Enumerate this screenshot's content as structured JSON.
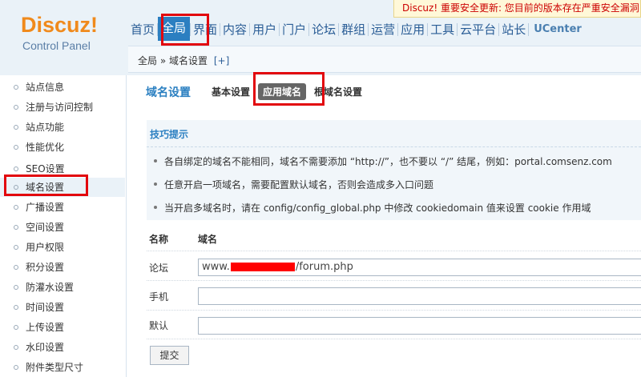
{
  "alert": {
    "text": "Discuz! 重要安全更新: 您目前的版本存在严重安全漏洞"
  },
  "logo": {
    "title": "Discuz!",
    "subtitle": "Control Panel"
  },
  "topnav": {
    "items": [
      "首页",
      "全局",
      "界面",
      "内容",
      "用户",
      "门户",
      "论坛",
      "群组",
      "运营",
      "应用",
      "工具",
      "云平台",
      "站长",
      "UCenter"
    ],
    "active_index": 1
  },
  "breadcrumb": {
    "section": "全局",
    "separator": "»",
    "page": "域名设置",
    "add": "[+]"
  },
  "sidebar": {
    "items": [
      "站点信息",
      "注册与访问控制",
      "站点功能",
      "性能优化",
      "SEO设置",
      "域名设置",
      "广播设置",
      "空间设置",
      "用户权限",
      "积分设置",
      "防灌水设置",
      "时间设置",
      "上传设置",
      "水印设置",
      "附件类型尺寸"
    ],
    "active_index": 5
  },
  "page": {
    "title": "域名设置",
    "tabs": [
      "基本设置",
      "应用域名",
      "根域名设置"
    ],
    "active_tab": 1
  },
  "tips": {
    "heading": "技巧提示",
    "lines": [
      "各自绑定的域名不能相同，域名不需要添加 “http://”，也不要以 “/” 结尾，例如：portal.comsenz.com",
      "任意开启一项域名，需要配置默认域名，否则会造成多入口问题",
      "当开启多域名时，请在 config/config_global.php 中修改 cookiedomain 值来设置 cookie 作用域"
    ]
  },
  "form": {
    "col_name": "名称",
    "col_domain": "域名",
    "rows": [
      {
        "label": "论坛",
        "value_prefix": "www.",
        "value_suffix": "/forum.php"
      },
      {
        "label": "手机",
        "value_prefix": "",
        "value_suffix": ""
      },
      {
        "label": "默认",
        "value_prefix": "",
        "value_suffix": ""
      }
    ],
    "submit_label": "提交"
  }
}
